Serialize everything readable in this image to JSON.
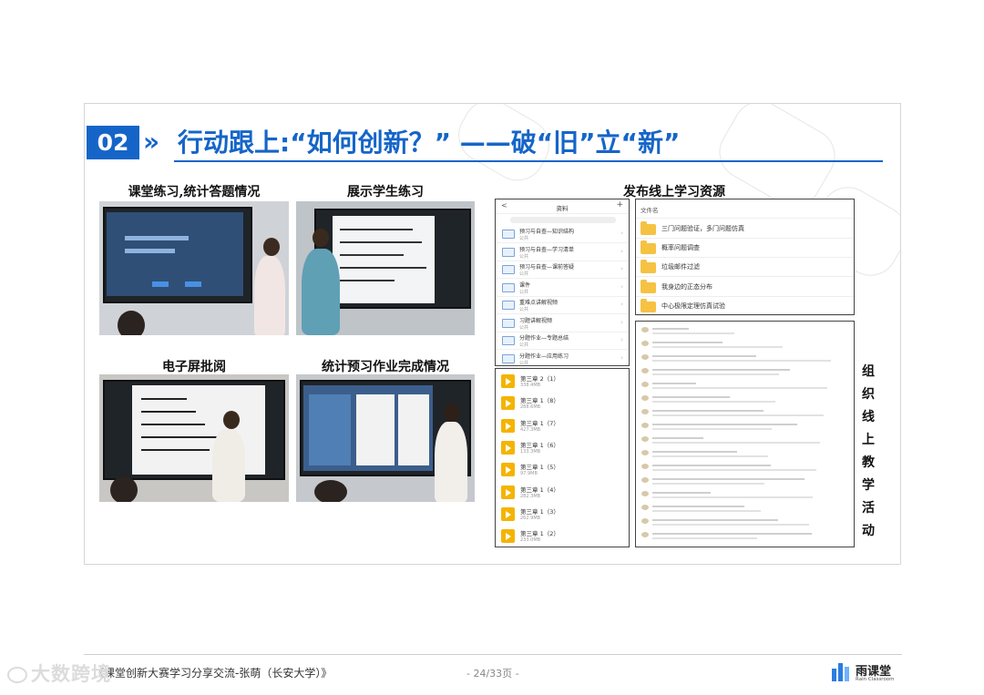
{
  "slide": {
    "number": "02",
    "chevron": "»",
    "title": "行动跟上:“如何创新？” ——破“旧”立“新”",
    "captions": {
      "practice": "课堂练习,统计答题情况",
      "display": "展示学生练习",
      "resources": "发布线上学习资源",
      "marking": "电子屏批阅",
      "preview": "统计预习作业完成情况"
    },
    "vertical_label": [
      "组",
      "织",
      "线",
      "上",
      "教",
      "学",
      "活",
      "动"
    ]
  },
  "phone_list": {
    "title": "资料",
    "back": "<",
    "add": "+",
    "items": [
      {
        "name": "预习与自查—知识结构",
        "sub": "公共"
      },
      {
        "name": "预习与自查—学习清单",
        "sub": "公共"
      },
      {
        "name": "预习与自查—课前答疑",
        "sub": "公共"
      },
      {
        "name": "课件",
        "sub": "公共"
      },
      {
        "name": "重难点讲解视频",
        "sub": "公共"
      },
      {
        "name": "习题讲解视频",
        "sub": "公共"
      },
      {
        "name": "分题作业—专题总结",
        "sub": "公共"
      },
      {
        "name": "分题作业—应用练习",
        "sub": "公共"
      }
    ]
  },
  "video_list": [
    {
      "name": "第三章 2（1）",
      "size": "338.4MB"
    },
    {
      "name": "第三章 1（8）",
      "size": "288.6MB"
    },
    {
      "name": "第三章 1（7）",
      "size": "427.3MB"
    },
    {
      "name": "第三章 1（6）",
      "size": "133.3MB"
    },
    {
      "name": "第三章 1（5）",
      "size": "97.9MB"
    },
    {
      "name": "第三章 1（4）",
      "size": "282.3MB"
    },
    {
      "name": "第三章 1（3）",
      "size": "262.9MB"
    },
    {
      "name": "第三章 1（2）",
      "size": "233.0MB"
    }
  ],
  "folders": {
    "header": "文件名",
    "items": [
      "三门问题验证，多门问题仿真",
      "概率问题调查",
      "垃圾邮件过滤",
      "我身边的正态分布",
      "中心极限定理仿真试验"
    ]
  },
  "footer": {
    "left": "《课堂创新大赛学习分享交流-张萌（长安大学）》",
    "page": "- 24/33页 -",
    "logo_cn": "雨课堂",
    "logo_en": "Rain Classroom",
    "watermark": "大数跨境"
  },
  "colors": {
    "accent": "#1565c8",
    "folder": "#f5c242",
    "video": "#f4b400"
  }
}
